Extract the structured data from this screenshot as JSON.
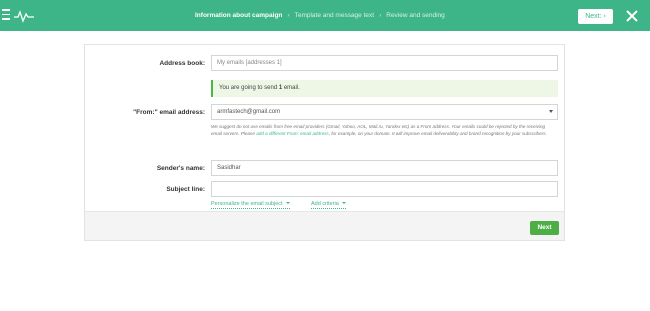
{
  "topbar": {
    "steps": [
      {
        "label": "Information about campaign",
        "active": true
      },
      {
        "label": "Template and message text",
        "active": false
      },
      {
        "label": "Review and sending",
        "active": false
      }
    ],
    "separator": "›",
    "next_label": "Next: ›"
  },
  "form": {
    "address_book": {
      "label": "Address book:",
      "value": "My emails [addresses 1]"
    },
    "info": {
      "prefix": "You are going to send ",
      "count": "1",
      "suffix": " email."
    },
    "from_email": {
      "label": "\"From:\" email address:",
      "value": "armfastech@gmail.com",
      "hint_before": "We suggest do not use emails from free email providers (Gmail, Yahoo, AOL, Mail.ru, Yandex etc) as a From address. Your emails could be rejected by the receiving email servers. Please ",
      "hint_link": "add a different From: email address",
      "hint_after": ", for example, on your domain. It will improve email deliverability and brand recognition by your subscribers."
    },
    "sender_name": {
      "label": "Sender's name:",
      "value": "Sasidhar"
    },
    "subject_line": {
      "label": "Subject line:",
      "value": ""
    },
    "personalize_link": "Personalize the email subject",
    "add_criteria_link": "Add criteria",
    "next_button": "Next"
  },
  "colors": {
    "accent": "#3db588",
    "button_green": "#4cae45"
  }
}
